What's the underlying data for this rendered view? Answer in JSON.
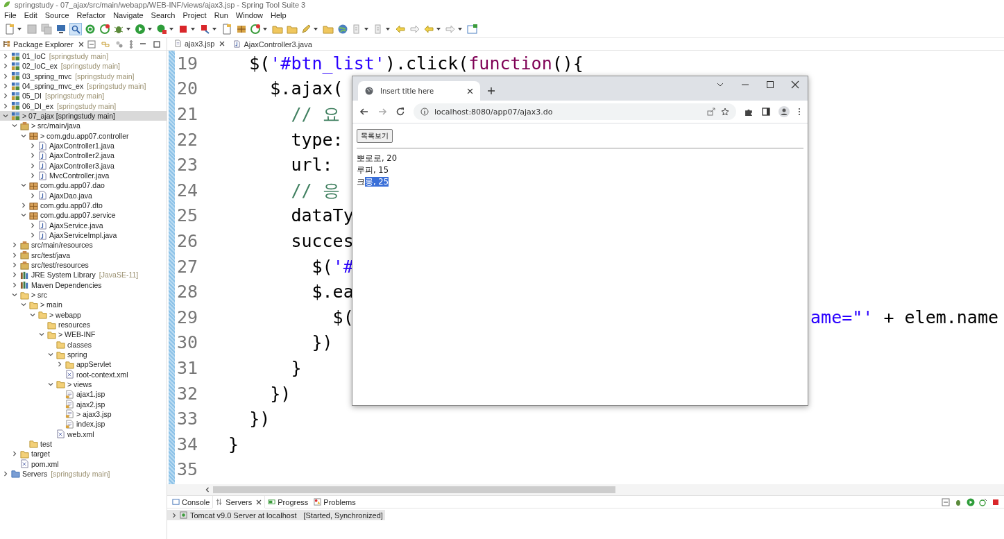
{
  "window": {
    "title": "springstudy - 07_ajax/src/main/webapp/WEB-INF/views/ajax3.jsp - Spring Tool Suite 3"
  },
  "menu_bar": [
    "File",
    "Edit",
    "Source",
    "Refactor",
    "Navigate",
    "Search",
    "Project",
    "Run",
    "Window",
    "Help"
  ],
  "toolbar": [
    {
      "kind": "doc",
      "dropdown": true,
      "pressed": false
    },
    {
      "kind": "disk",
      "dropdown": false,
      "pressed": false
    },
    {
      "kind": "disks",
      "dropdown": false,
      "pressed": false
    },
    {
      "kind": "monitor",
      "dropdown": false,
      "pressed": false
    },
    {
      "kind": "magnifier",
      "dropdown": false,
      "pressed": true
    },
    {
      "kind": "power",
      "dropdown": false,
      "pressed": false
    },
    {
      "kind": "refresh",
      "dropdown": false,
      "pressed": false
    },
    {
      "kind": "bug",
      "dropdown": true,
      "pressed": false
    },
    {
      "kind": "play",
      "dropdown": true,
      "pressed": false
    },
    {
      "kind": "play-stop",
      "dropdown": true,
      "pressed": false
    },
    {
      "kind": "square",
      "dropdown": true,
      "pressed": false
    },
    {
      "kind": "flag",
      "dropdown": true,
      "pressed": false
    },
    {
      "kind": "doc",
      "dropdown": false,
      "pressed": false
    },
    {
      "kind": "grid",
      "dropdown": false,
      "pressed": false
    },
    {
      "kind": "refresh",
      "dropdown": true,
      "pressed": false
    },
    {
      "kind": "folder",
      "dropdown": false,
      "pressed": false
    },
    {
      "kind": "folder",
      "dropdown": false,
      "pressed": false
    },
    {
      "kind": "pen",
      "dropdown": true,
      "pressed": false
    },
    {
      "kind": "folder",
      "dropdown": false,
      "pressed": false
    },
    {
      "kind": "globe",
      "dropdown": false,
      "pressed": false
    },
    {
      "kind": "marker",
      "dropdown": true,
      "pressed": false
    },
    {
      "kind": "marker",
      "dropdown": true,
      "pressed": false
    },
    {
      "kind": "arrow-back",
      "dropdown": false,
      "pressed": false
    },
    {
      "kind": "arrow-forward",
      "dropdown": false,
      "pressed": false
    },
    {
      "kind": "arrow-back",
      "dropdown": true,
      "pressed": false
    },
    {
      "kind": "arrow-forward",
      "dropdown": true,
      "pressed": false
    },
    {
      "kind": "window",
      "dropdown": false,
      "pressed": false
    }
  ],
  "package_explorer": {
    "title": "Package Explorer",
    "items": [
      {
        "kind": "project",
        "label": "01_IoC",
        "decoration": "[springstudy main]",
        "expanded": false,
        "selected": false
      },
      {
        "kind": "project",
        "label": "02_IoC_ex",
        "decoration": "[springstudy main]",
        "expanded": false,
        "selected": false
      },
      {
        "kind": "project",
        "label": "03_spring_mvc",
        "decoration": "[springstudy main]",
        "expanded": false,
        "selected": false
      },
      {
        "kind": "project",
        "label": "04_spring_mvc_ex",
        "decoration": "[springstudy main]",
        "expanded": false,
        "selected": false
      },
      {
        "kind": "project",
        "label": "05_DI",
        "decoration": "[springstudy main]",
        "expanded": false,
        "selected": false
      },
      {
        "kind": "project",
        "label": "06_DI_ex",
        "decoration": "[springstudy main]",
        "expanded": false,
        "selected": false
      },
      {
        "kind": "project",
        "label": "> 07_ajax [springstudy main]",
        "expanded": true,
        "selected": true,
        "children": [
          {
            "kind": "source",
            "label": "> src/main/java",
            "expanded": true,
            "selected": false,
            "children": [
              {
                "kind": "package",
                "label": "> com.gdu.app07.controller",
                "expanded": true,
                "selected": false,
                "children": [
                  {
                    "kind": "java",
                    "label": "AjaxController1.java",
                    "expanded": false,
                    "selected": false
                  },
                  {
                    "kind": "java",
                    "label": "AjaxController2.java",
                    "expanded": false,
                    "selected": false
                  },
                  {
                    "kind": "java",
                    "label": "AjaxController3.java",
                    "expanded": false,
                    "selected": false
                  },
                  {
                    "kind": "java",
                    "label": "MvcController.java",
                    "expanded": false,
                    "selected": false
                  }
                ]
              },
              {
                "kind": "package",
                "label": "com.gdu.app07.dao",
                "expanded": true,
                "selected": false,
                "children": [
                  {
                    "kind": "java",
                    "label": "AjaxDao.java",
                    "expanded": false,
                    "selected": false
                  }
                ]
              },
              {
                "kind": "package",
                "label": "com.gdu.app07.dto",
                "expanded": false,
                "selected": false
              },
              {
                "kind": "package",
                "label": "com.gdu.app07.service",
                "expanded": true,
                "selected": false,
                "children": [
                  {
                    "kind": "java",
                    "label": "AjaxService.java",
                    "expanded": false,
                    "selected": false
                  },
                  {
                    "kind": "java",
                    "label": "AjaxServiceImpl.java",
                    "expanded": false,
                    "selected": false
                  }
                ]
              }
            ]
          },
          {
            "kind": "source",
            "label": "src/main/resources",
            "expanded": false,
            "selected": false
          },
          {
            "kind": "source",
            "label": "src/test/java",
            "expanded": false,
            "selected": false
          },
          {
            "kind": "source",
            "label": "src/test/resources",
            "expanded": false,
            "selected": false
          },
          {
            "kind": "library",
            "label": "JRE System Library",
            "decoration": "[JavaSE-11]",
            "expanded": false,
            "selected": false
          },
          {
            "kind": "library",
            "label": "Maven Dependencies",
            "expanded": false,
            "selected": false
          },
          {
            "kind": "folder",
            "label": "> src",
            "expanded": true,
            "selected": false,
            "children": [
              {
                "kind": "folder",
                "label": "> main",
                "expanded": true,
                "selected": false,
                "children": [
                  {
                    "kind": "folder",
                    "label": "> webapp",
                    "expanded": true,
                    "selected": false,
                    "children": [
                      {
                        "kind": "folder",
                        "label": "resources",
                        "selected": false
                      },
                      {
                        "kind": "folder",
                        "label": "> WEB-INF",
                        "expanded": true,
                        "selected": false,
                        "children": [
                          {
                            "kind": "folder",
                            "label": "classes",
                            "selected": false
                          },
                          {
                            "kind": "folder",
                            "label": "spring",
                            "expanded": true,
                            "selected": false,
                            "children": [
                              {
                                "kind": "folder",
                                "label": "appServlet",
                                "expanded": false,
                                "selected": false
                              },
                              {
                                "kind": "xml",
                                "label": "root-context.xml",
                                "selected": false
                              }
                            ]
                          },
                          {
                            "kind": "folder",
                            "label": "> views",
                            "expanded": true,
                            "selected": false,
                            "children": [
                              {
                                "kind": "jsp",
                                "label": "ajax1.jsp",
                                "selected": false
                              },
                              {
                                "kind": "jsp",
                                "label": "ajax2.jsp",
                                "selected": false
                              },
                              {
                                "kind": "jsp",
                                "label": "> ajax3.jsp",
                                "selected": false
                              },
                              {
                                "kind": "jsp",
                                "label": "index.jsp",
                                "selected": false
                              }
                            ]
                          },
                          {
                            "kind": "xml",
                            "label": "web.xml",
                            "selected": false
                          }
                        ]
                      }
                    ]
                  }
                ]
              },
              {
                "kind": "folder",
                "label": "test",
                "selected": false
              }
            ]
          },
          {
            "kind": "folder",
            "label": "target",
            "expanded": false,
            "selected": false
          },
          {
            "kind": "xml",
            "label": "pom.xml",
            "selected": false
          }
        ]
      },
      {
        "kind": "servers",
        "label": "Servers",
        "decoration": "[springstudy main]",
        "expanded": false,
        "selected": false
      }
    ]
  },
  "editor": {
    "tabs": [
      {
        "label": "ajax3.jsp",
        "kind": "jsp",
        "selected": true
      },
      {
        "label": "AjaxController3.java",
        "kind": "java",
        "selected": false
      }
    ],
    "lines": [
      {
        "number": "19",
        "segments": [
          {
            "text": "    $(",
            "kind": "plain"
          },
          {
            "text": "'#btn_list'",
            "kind": "string"
          },
          {
            "text": ").click(",
            "kind": "plain"
          },
          {
            "text": "function",
            "kind": "keyword"
          },
          {
            "text": "(){",
            "kind": "plain"
          }
        ]
      },
      {
        "number": "20",
        "segments": [
          {
            "text": "      $.ajax(",
            "kind": "plain"
          }
        ]
      },
      {
        "number": "21",
        "segments": [
          {
            "text": "        // 요",
            "kind": "comment"
          }
        ]
      },
      {
        "number": "22",
        "segments": [
          {
            "text": "        type:",
            "kind": "plain"
          }
        ]
      },
      {
        "number": "23",
        "segments": [
          {
            "text": "        url:",
            "kind": "plain"
          }
        ]
      },
      {
        "number": "24",
        "segments": [
          {
            "text": "        // 응",
            "kind": "comment"
          }
        ]
      },
      {
        "number": "25",
        "segments": [
          {
            "text": "        dataTy",
            "kind": "plain"
          }
        ]
      },
      {
        "number": "26",
        "segments": [
          {
            "text": "        succes",
            "kind": "plain"
          }
        ]
      },
      {
        "number": "27",
        "segments": [
          {
            "text": "          $(",
            "kind": "plain"
          },
          {
            "text": "'#",
            "kind": "string"
          }
        ]
      },
      {
        "number": "28",
        "segments": [
          {
            "text": "          $.ea",
            "kind": "plain"
          }
        ]
      },
      {
        "number": "29",
        "segments": [
          {
            "text": "            $(",
            "kind": "plain"
          }
        ],
        "right_segments": [
          {
            "text": "ame=\"'",
            "kind": "string"
          },
          {
            "text": " + elem.name",
            "kind": "plain"
          }
        ]
      },
      {
        "number": "30",
        "segments": [
          {
            "text": "          })",
            "kind": "plain"
          }
        ]
      },
      {
        "number": "31",
        "segments": [
          {
            "text": "        }",
            "kind": "plain"
          }
        ]
      },
      {
        "number": "32",
        "segments": [
          {
            "text": "      })",
            "kind": "plain"
          }
        ]
      },
      {
        "number": "33",
        "segments": [
          {
            "text": "    })",
            "kind": "plain"
          }
        ]
      },
      {
        "number": "34",
        "segments": [
          {
            "text": "  }",
            "kind": "plain"
          }
        ]
      },
      {
        "number": "35"
      }
    ]
  },
  "browser": {
    "tab_title": "Insert title here",
    "url": "localhost:8080/app07/ajax3.do",
    "page": {
      "button": "목록보기",
      "entries": [
        {
          "parts": [
            {
              "text": "뽀로로, 20",
              "selected": false
            }
          ]
        },
        {
          "parts": [
            {
              "text": "루피, 15",
              "selected": false
            }
          ]
        },
        {
          "parts": [
            {
              "text": "크",
              "selected": false
            },
            {
              "text": "롱, 25",
              "selected": true
            }
          ]
        }
      ]
    }
  },
  "bottom_panel": {
    "tabs": [
      {
        "label": "Console",
        "kind": "console",
        "selected": false
      },
      {
        "label": "Servers",
        "kind": "servers",
        "selected": true
      },
      {
        "label": "Progress",
        "kind": "progress",
        "selected": false
      },
      {
        "label": "Problems",
        "kind": "problems",
        "selected": false
      }
    ],
    "servers": [
      {
        "name": "Tomcat v9.0 Server at localhost",
        "status": "[Started, Synchronized]",
        "selected": true
      }
    ]
  }
}
